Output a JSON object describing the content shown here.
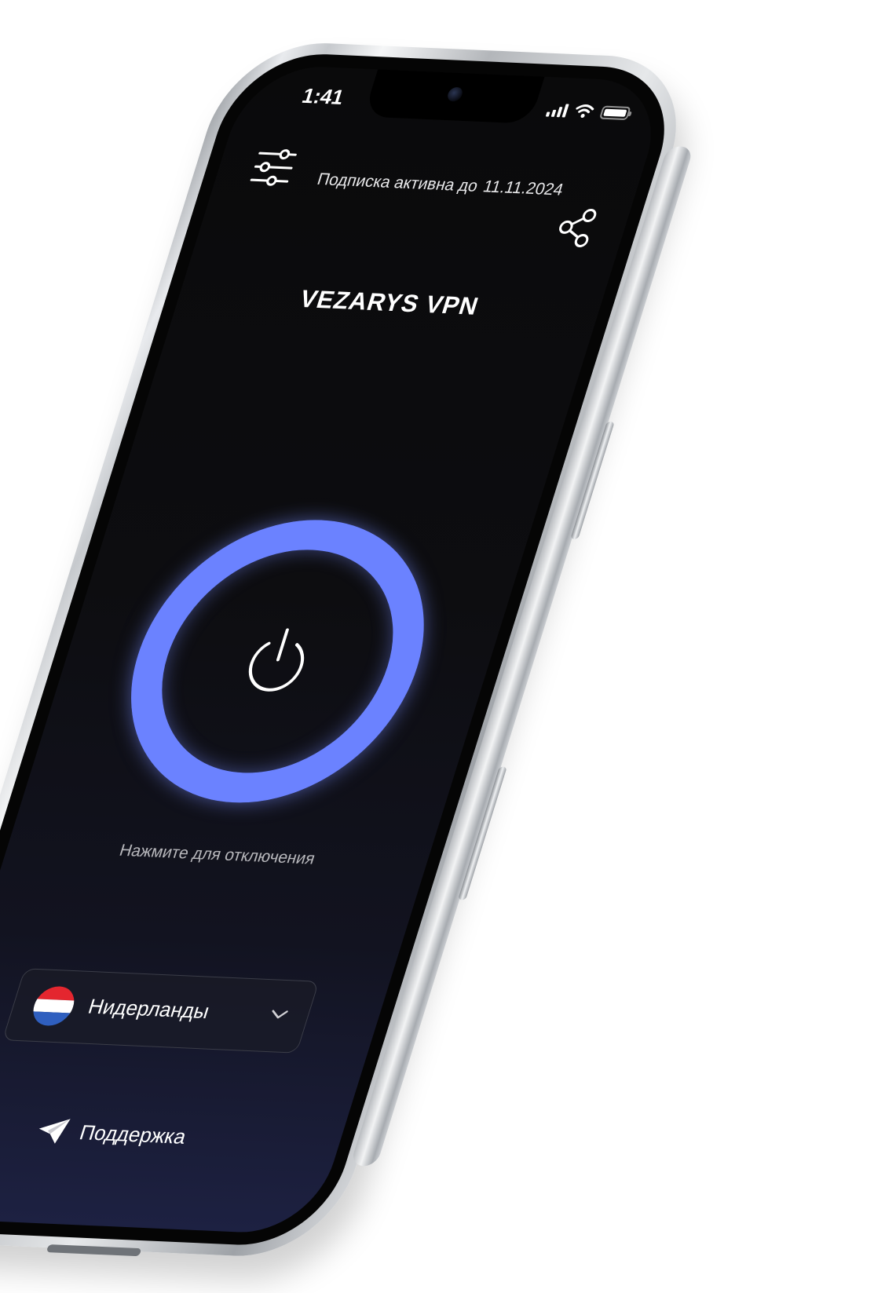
{
  "status_bar": {
    "time": "1:41",
    "signal_bars": 4,
    "battery_level": 1.0
  },
  "header": {
    "subscription_label": "Подписка активна до",
    "subscription_date": "11.11.2024",
    "settings_icon": "sliders-icon",
    "share_icon": "share-icon"
  },
  "app": {
    "title": "VEZARYS VPN"
  },
  "connection": {
    "hint": "Нажмите для отключения",
    "state": "connected",
    "ring_color": "#6b82ff",
    "power_icon": "power-icon"
  },
  "location": {
    "country": "Нидерланды",
    "flag_colors": [
      "#e4262f",
      "#ffffff",
      "#2f5fbf"
    ],
    "dropdown_icon": "chevron-down-icon"
  },
  "support": {
    "label": "Поддержка",
    "icon": "paper-plane-icon"
  }
}
